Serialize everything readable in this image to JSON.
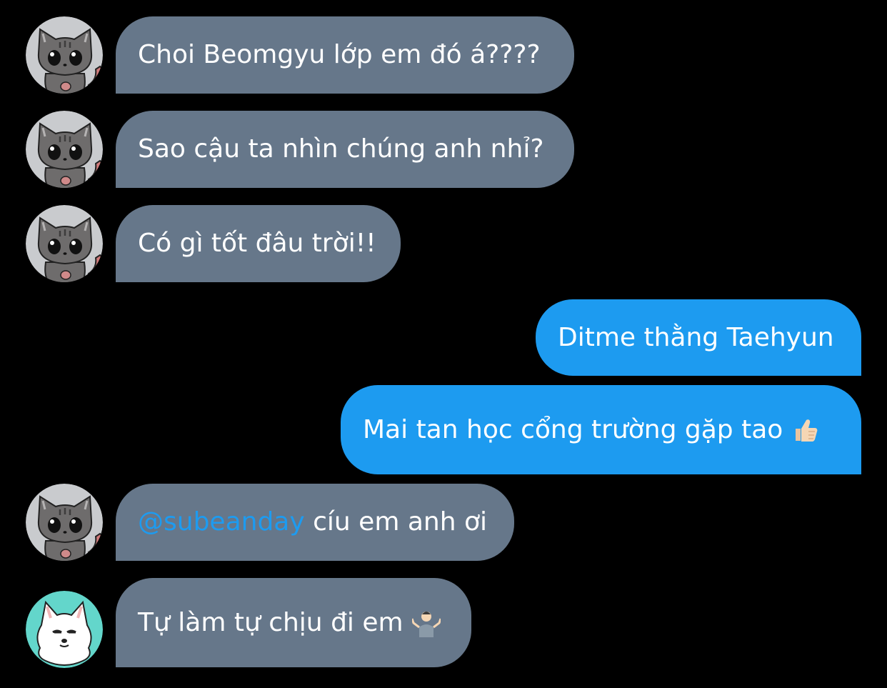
{
  "conversation": {
    "messages": [
      {
        "sender": "other",
        "avatar": "cat-avatar-icon",
        "text": "Choi Beomgyu lớp em đó á????"
      },
      {
        "sender": "other",
        "avatar": "cat-avatar-icon",
        "text": "Sao cậu ta nhìn chúng anh nhỉ?"
      },
      {
        "sender": "other",
        "avatar": "cat-avatar-icon",
        "text": "Có gì tốt đâu trời!!"
      },
      {
        "sender": "self",
        "text": "Ditme thằng Taehyun"
      },
      {
        "sender": "self",
        "text": "Mai tan học cổng trường gặp tao",
        "emoji": "thumbs-up-icon"
      },
      {
        "sender": "other",
        "avatar": "cat-avatar-icon",
        "mention": "@subeanday",
        "text": " cíu em anh ơi"
      },
      {
        "sender": "other",
        "avatar": "white-dog-avatar-icon",
        "text": "Tự làm tự chịu đi em",
        "emoji": "person-shrugging-icon"
      }
    ]
  },
  "colors": {
    "background": "#000000",
    "incoming_bubble": "#66778a",
    "outgoing_bubble": "#1d9bf0",
    "mention": "#1d9bf0",
    "text": "#ffffff"
  }
}
